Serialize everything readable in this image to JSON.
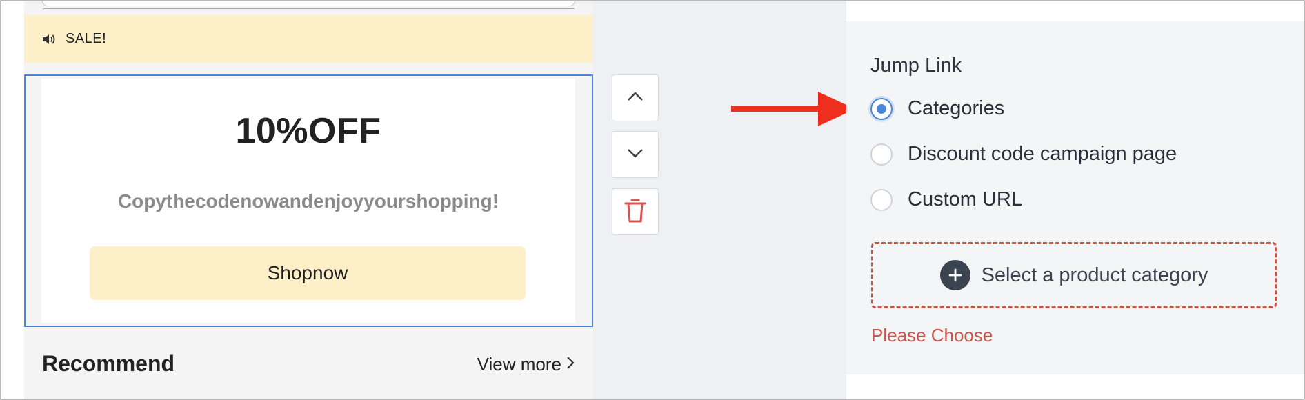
{
  "announcement": {
    "icon": "speaker-icon",
    "text": "SALE!"
  },
  "promo": {
    "headline": "10%OFF",
    "subtitle": "Copythecodenowandenjoyyourshopping!",
    "button_label": "Shopnow"
  },
  "recommend": {
    "title": "Recommend",
    "view_more": "View more"
  },
  "controls": {
    "up_icon": "chevron-up-icon",
    "down_icon": "chevron-down-icon",
    "delete_icon": "trash-icon"
  },
  "jump_link": {
    "label": "Jump Link",
    "options": [
      {
        "label": "Categories",
        "selected": true
      },
      {
        "label": "Discount code campaign page",
        "selected": false
      },
      {
        "label": "Custom URL",
        "selected": false
      }
    ],
    "select_category_label": "Select a product category",
    "error": "Please Choose"
  },
  "colors": {
    "accent_blue": "#4a86d9",
    "banner_yellow": "#fdefc8",
    "error_red": "#c9564a",
    "annotation_arrow": "#ee2e1f"
  }
}
